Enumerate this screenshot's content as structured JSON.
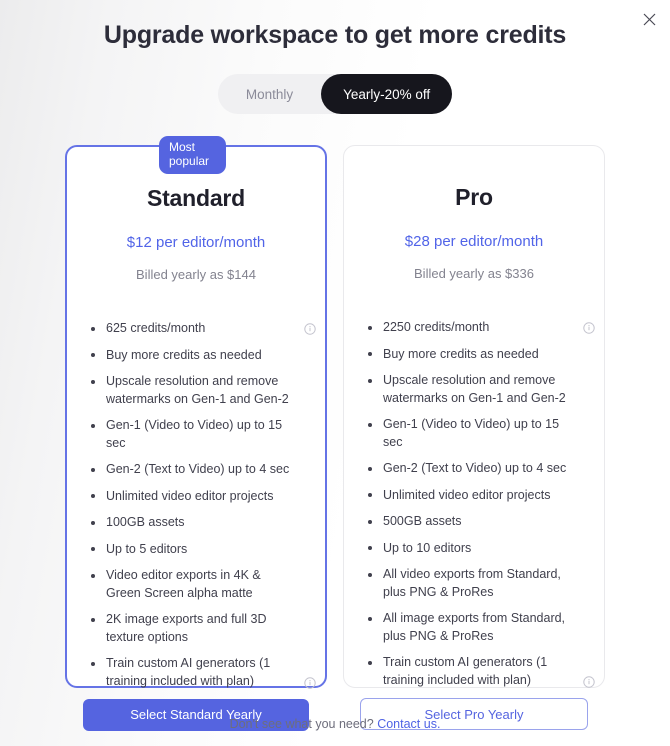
{
  "modal": {
    "title": "Upgrade workspace to get more credits",
    "close_icon": "close-icon"
  },
  "billing_toggle": {
    "monthly_label": "Monthly",
    "yearly_label": "Yearly-20% off",
    "selected": "Yearly-20% off"
  },
  "accent_colors": {
    "primary_blue": "#5564e0",
    "price_blue": "#5164e8",
    "toggle_active_bg": "#16161d",
    "toggle_track_bg": "#f0f0f2",
    "muted_text": "#83838f"
  },
  "plans": [
    {
      "badge": "Most popular",
      "name": "Standard",
      "price": "$12 per editor/month",
      "billing": "Billed yearly as $144",
      "features": [
        {
          "text": "625 credits/month",
          "info": true
        },
        {
          "text": "Buy more credits as needed",
          "info": false
        },
        {
          "text": "Upscale resolution and remove watermarks on Gen-1 and Gen-2",
          "info": false
        },
        {
          "text": "Gen-1 (Video to Video) up to 15 sec",
          "info": false
        },
        {
          "text": "Gen-2 (Text to Video) up to 4 sec",
          "info": false
        },
        {
          "text": "Unlimited video editor projects",
          "info": false
        },
        {
          "text": "100GB assets",
          "info": false
        },
        {
          "text": "Up to 5 editors",
          "info": false
        },
        {
          "text": "Video editor exports in 4K & Green Screen alpha matte",
          "info": false
        },
        {
          "text": "2K image exports and full 3D texture options",
          "info": false
        },
        {
          "text": "Train custom AI generators (1 training included with plan)",
          "info": true
        }
      ],
      "cta": "Select Standard Yearly"
    },
    {
      "badge": null,
      "name": "Pro",
      "price": "$28 per editor/month",
      "billing": "Billed yearly as $336",
      "features": [
        {
          "text": "2250 credits/month",
          "info": true
        },
        {
          "text": "Buy more credits as needed",
          "info": false
        },
        {
          "text": "Upscale resolution and remove watermarks on Gen-1 and Gen-2",
          "info": false
        },
        {
          "text": "Gen-1 (Video to Video) up to 15 sec",
          "info": false
        },
        {
          "text": "Gen-2 (Text to Video) up to 4 sec",
          "info": false
        },
        {
          "text": "Unlimited video editor projects",
          "info": false
        },
        {
          "text": "500GB assets",
          "info": false
        },
        {
          "text": "Up to 10 editors",
          "info": false
        },
        {
          "text": "All video exports from Standard, plus PNG & ProRes",
          "info": false
        },
        {
          "text": "All image exports from Standard, plus PNG & ProRes",
          "info": false
        },
        {
          "text": "Train custom AI generators (1 training included with plan)",
          "info": true
        }
      ],
      "cta": "Select Pro Yearly"
    }
  ],
  "footer": {
    "text": "Don't see what you need?",
    "link": "Contact us."
  }
}
